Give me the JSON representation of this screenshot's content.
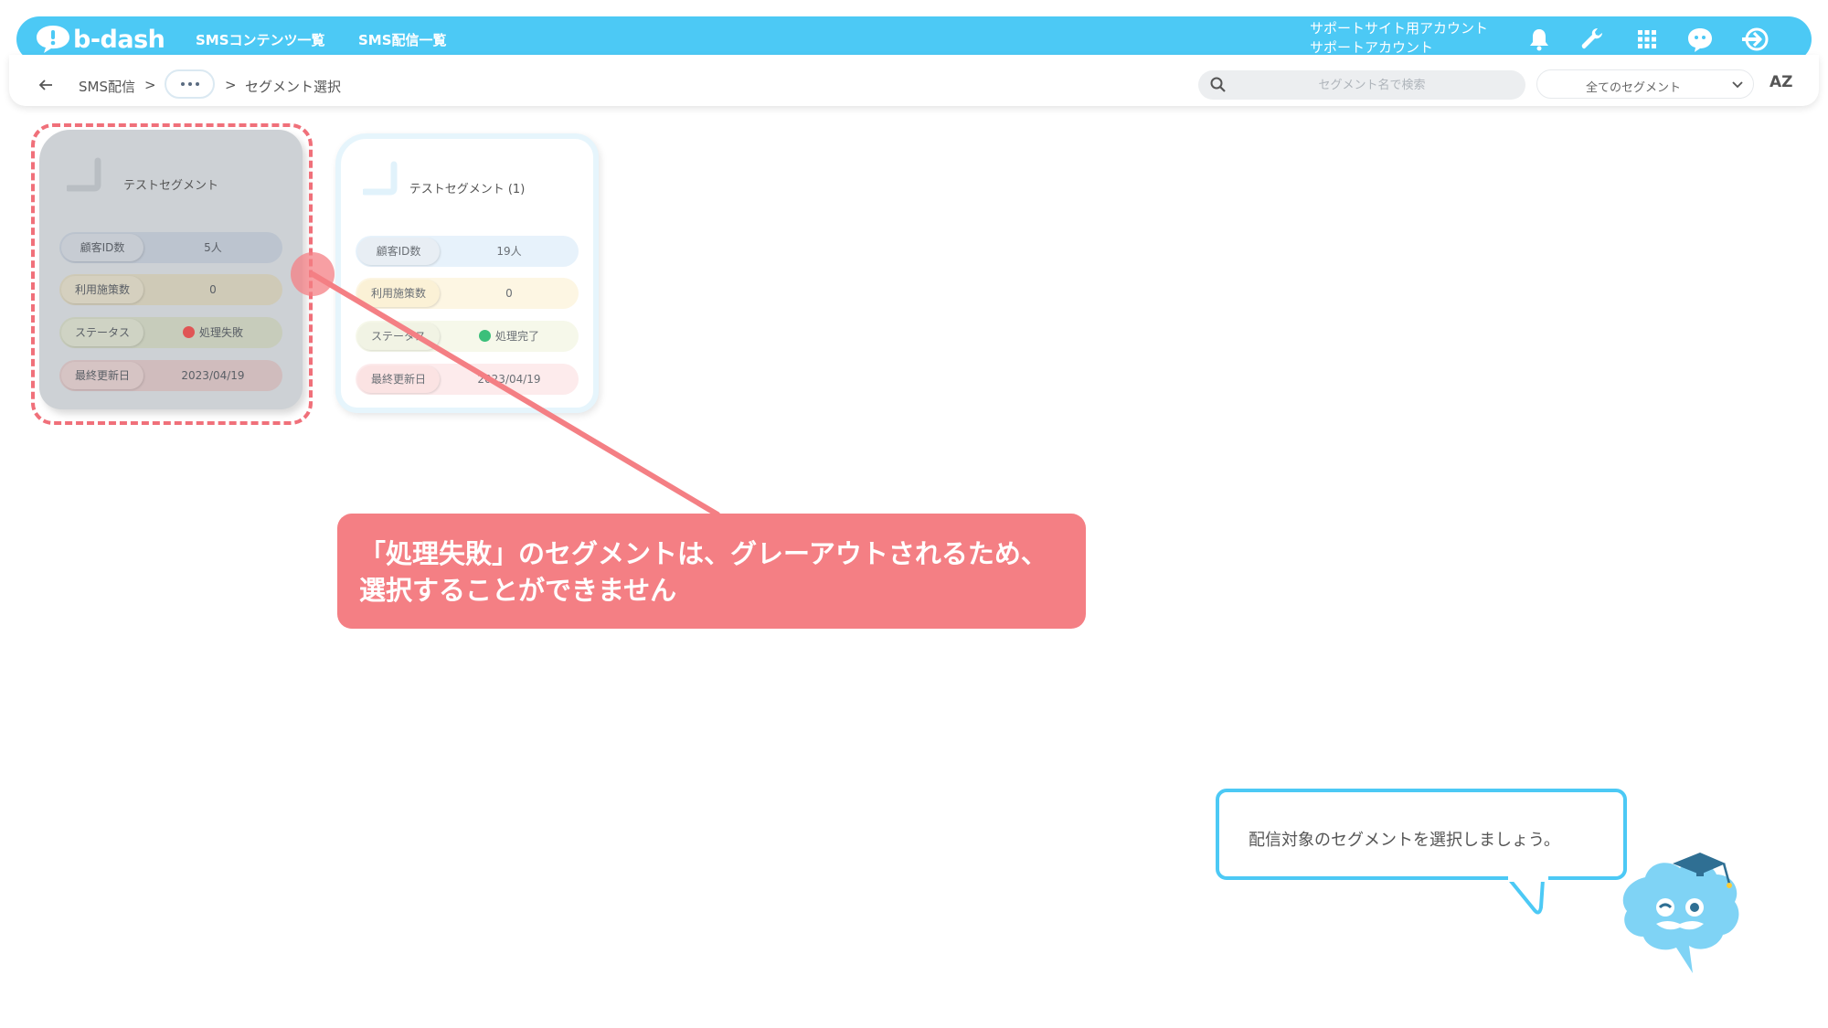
{
  "header": {
    "logo_text": "b-dash",
    "nav": [
      "SMSコンテンツ一覧",
      "SMS配信一覧"
    ],
    "account_line1": "サポートサイト用アカウント",
    "account_line2": "サポートアカウント",
    "icons": [
      "bell-icon",
      "wrench-icon",
      "apps-grid-icon",
      "chat-icon",
      "logout-icon"
    ],
    "accent_color": "#4cc9f5"
  },
  "breadcrumb": {
    "root": "SMS配信",
    "sep": ">",
    "current": "セグメント選択"
  },
  "toolbar": {
    "search_placeholder": "セグメント名で検索",
    "filter_selected": "全てのセグメント",
    "sort_label": "AZ"
  },
  "cards": [
    {
      "title": "テストセグメント",
      "rows": [
        {
          "label": "顧客ID数",
          "value": "5人"
        },
        {
          "label": "利用施策数",
          "value": "0"
        },
        {
          "label": "ステータス",
          "value": "処理失敗"
        },
        {
          "label": "最終更新日",
          "value": "2023/04/19"
        }
      ],
      "status_color": "#e05555",
      "state": "disabled"
    },
    {
      "title": "テストセグメント (1)",
      "rows": [
        {
          "label": "顧客ID数",
          "value": "19人"
        },
        {
          "label": "利用施策数",
          "value": "0"
        },
        {
          "label": "ステータス",
          "value": "処理完了"
        },
        {
          "label": "最終更新日",
          "value": "2023/04/19"
        }
      ],
      "status_color": "#3bbf7a",
      "state": "selectable"
    }
  ],
  "annotation": {
    "line1": "「処理失敗」のセグメントは、グレーアウトされるため、",
    "line2": "選択することができません",
    "color": "#f47f84"
  },
  "tip": {
    "text": "配信対象のセグメントを選択しましょう。"
  }
}
